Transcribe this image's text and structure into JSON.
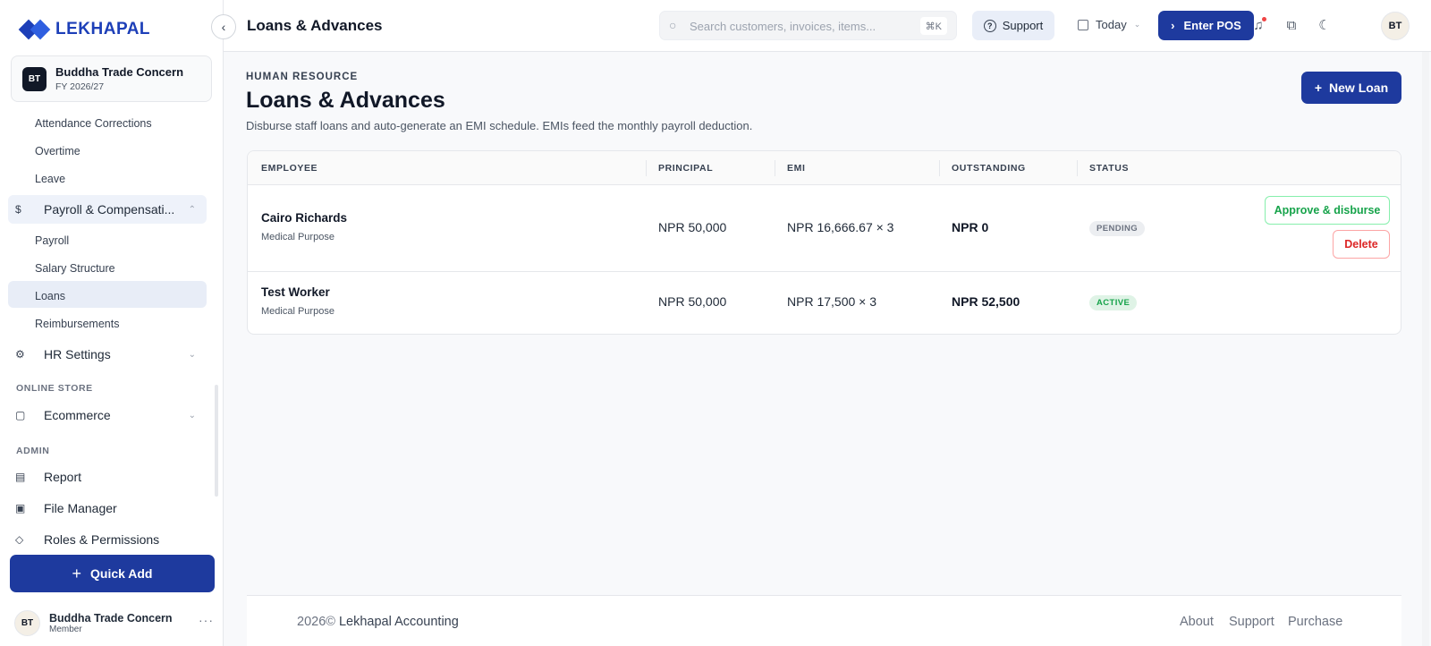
{
  "brand": {
    "name": "LEKHAPAL"
  },
  "org": {
    "initials": "BT",
    "name": "Buddha Trade Concern",
    "fy": "FY 2026/27"
  },
  "sidebar": {
    "hr_subitems": [
      "Attendance Corrections",
      "Overtime",
      "Leave"
    ],
    "payroll_group": {
      "label": "Payroll & Compensati...",
      "icon": "payroll-icon"
    },
    "payroll_subitems": [
      "Payroll",
      "Salary Structure",
      "Loans",
      "Reimbursements"
    ],
    "active_item": "Loans",
    "hr_settings": {
      "label": "HR Settings",
      "icon": "settings-icon"
    },
    "section_online_store": "ONLINE STORE",
    "ecommerce": {
      "label": "Ecommerce",
      "icon": "cart-icon"
    },
    "section_admin": "ADMIN",
    "report": {
      "label": "Report",
      "icon": "chart-icon"
    },
    "file_manager": {
      "label": "File Manager",
      "icon": "folder-icon"
    },
    "roles": {
      "label": "Roles & Permissions",
      "icon": "shield-icon"
    },
    "quick_add_label": "Quick Add",
    "user": {
      "initials": "BT",
      "name": "Buddha Trade Concern",
      "role": "Member"
    }
  },
  "topbar": {
    "title": "Loans & Advances",
    "search_placeholder": "Search customers, invoices, items...",
    "shortcut": "⌘K",
    "support_label": "Support",
    "date_filter": "Today",
    "enter_pos_label": "Enter POS",
    "avatar_initials": "BT"
  },
  "page": {
    "eyebrow": "HUMAN RESOURCE",
    "title": "Loans & Advances",
    "description": "Disburse staff loans and auto-generate an EMI schedule. EMIs feed the monthly payroll deduction.",
    "new_button": "New Loan"
  },
  "table": {
    "columns": [
      "EMPLOYEE",
      "PRINCIPAL",
      "EMI",
      "OUTSTANDING",
      "STATUS"
    ],
    "rows": [
      {
        "employee": "Cairo Richards",
        "purpose": "Medical Purpose",
        "principal": "NPR 50,000",
        "emi": "NPR 16,666.67 × 3",
        "outstanding": "NPR 0",
        "status": "PENDING",
        "actions": [
          "Approve & disburse",
          "Delete"
        ]
      },
      {
        "employee": "Test Worker",
        "purpose": "Medical Purpose",
        "principal": "NPR 50,000",
        "emi": "NPR 17,500 × 3",
        "outstanding": "NPR 52,500",
        "status": "ACTIVE"
      }
    ]
  },
  "footer": {
    "year": "2026©",
    "company": "Lekhapal Accounting",
    "links": [
      "About",
      "Support",
      "Purchase"
    ]
  }
}
